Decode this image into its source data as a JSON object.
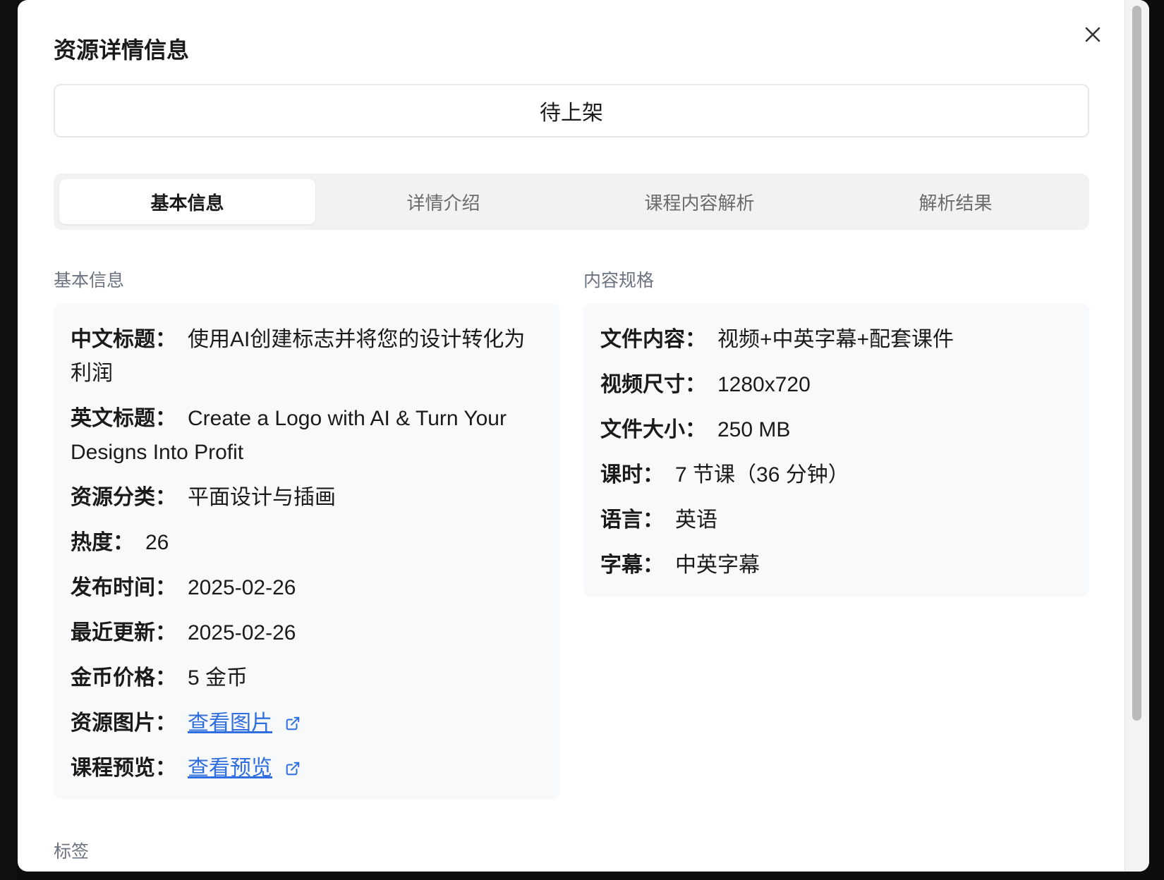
{
  "modal": {
    "title": "资源详情信息",
    "status": "待上架"
  },
  "tabs": [
    {
      "label": "基本信息",
      "active": true
    },
    {
      "label": "详情介绍",
      "active": false
    },
    {
      "label": "课程内容解析",
      "active": false
    },
    {
      "label": "解析结果",
      "active": false
    }
  ],
  "basic_info": {
    "section_title": "基本信息",
    "fields": {
      "cn_title": {
        "label": "中文标题：",
        "value": "使用AI创建标志并将您的设计转化为利润"
      },
      "en_title": {
        "label": "英文标题：",
        "value": "Create a Logo with AI & Turn Your Designs Into Profit"
      },
      "category": {
        "label": "资源分类：",
        "value": "平面设计与插画"
      },
      "popularity": {
        "label": "热度：",
        "value": "26"
      },
      "publish_date": {
        "label": "发布时间：",
        "value": "2025-02-26"
      },
      "update_date": {
        "label": "最近更新：",
        "value": "2025-02-26"
      },
      "price": {
        "label": "金币价格：",
        "value": "5 金币"
      },
      "image": {
        "label": "资源图片：",
        "link": "查看图片"
      },
      "preview": {
        "label": "课程预览：",
        "link": "查看预览"
      }
    }
  },
  "content_spec": {
    "section_title": "内容规格",
    "fields": {
      "file_content": {
        "label": "文件内容：",
        "value": "视频+中英字幕+配套课件"
      },
      "video_size": {
        "label": "视频尺寸：",
        "value": "1280x720"
      },
      "file_size": {
        "label": "文件大小：",
        "value": "250 MB"
      },
      "lessons": {
        "label": "课时：",
        "value": "7 节课（36 分钟）"
      },
      "language": {
        "label": "语言：",
        "value": "英语"
      },
      "subtitles": {
        "label": "字幕：",
        "value": "中英字幕"
      }
    }
  },
  "tags": {
    "section_title": "标签"
  },
  "icons": {
    "close": "close-icon",
    "external": "external-link-icon"
  },
  "colors": {
    "link": "#2f6fe0",
    "card_bg": "#f8f9fa",
    "tab_bg": "#f2f2f2"
  }
}
